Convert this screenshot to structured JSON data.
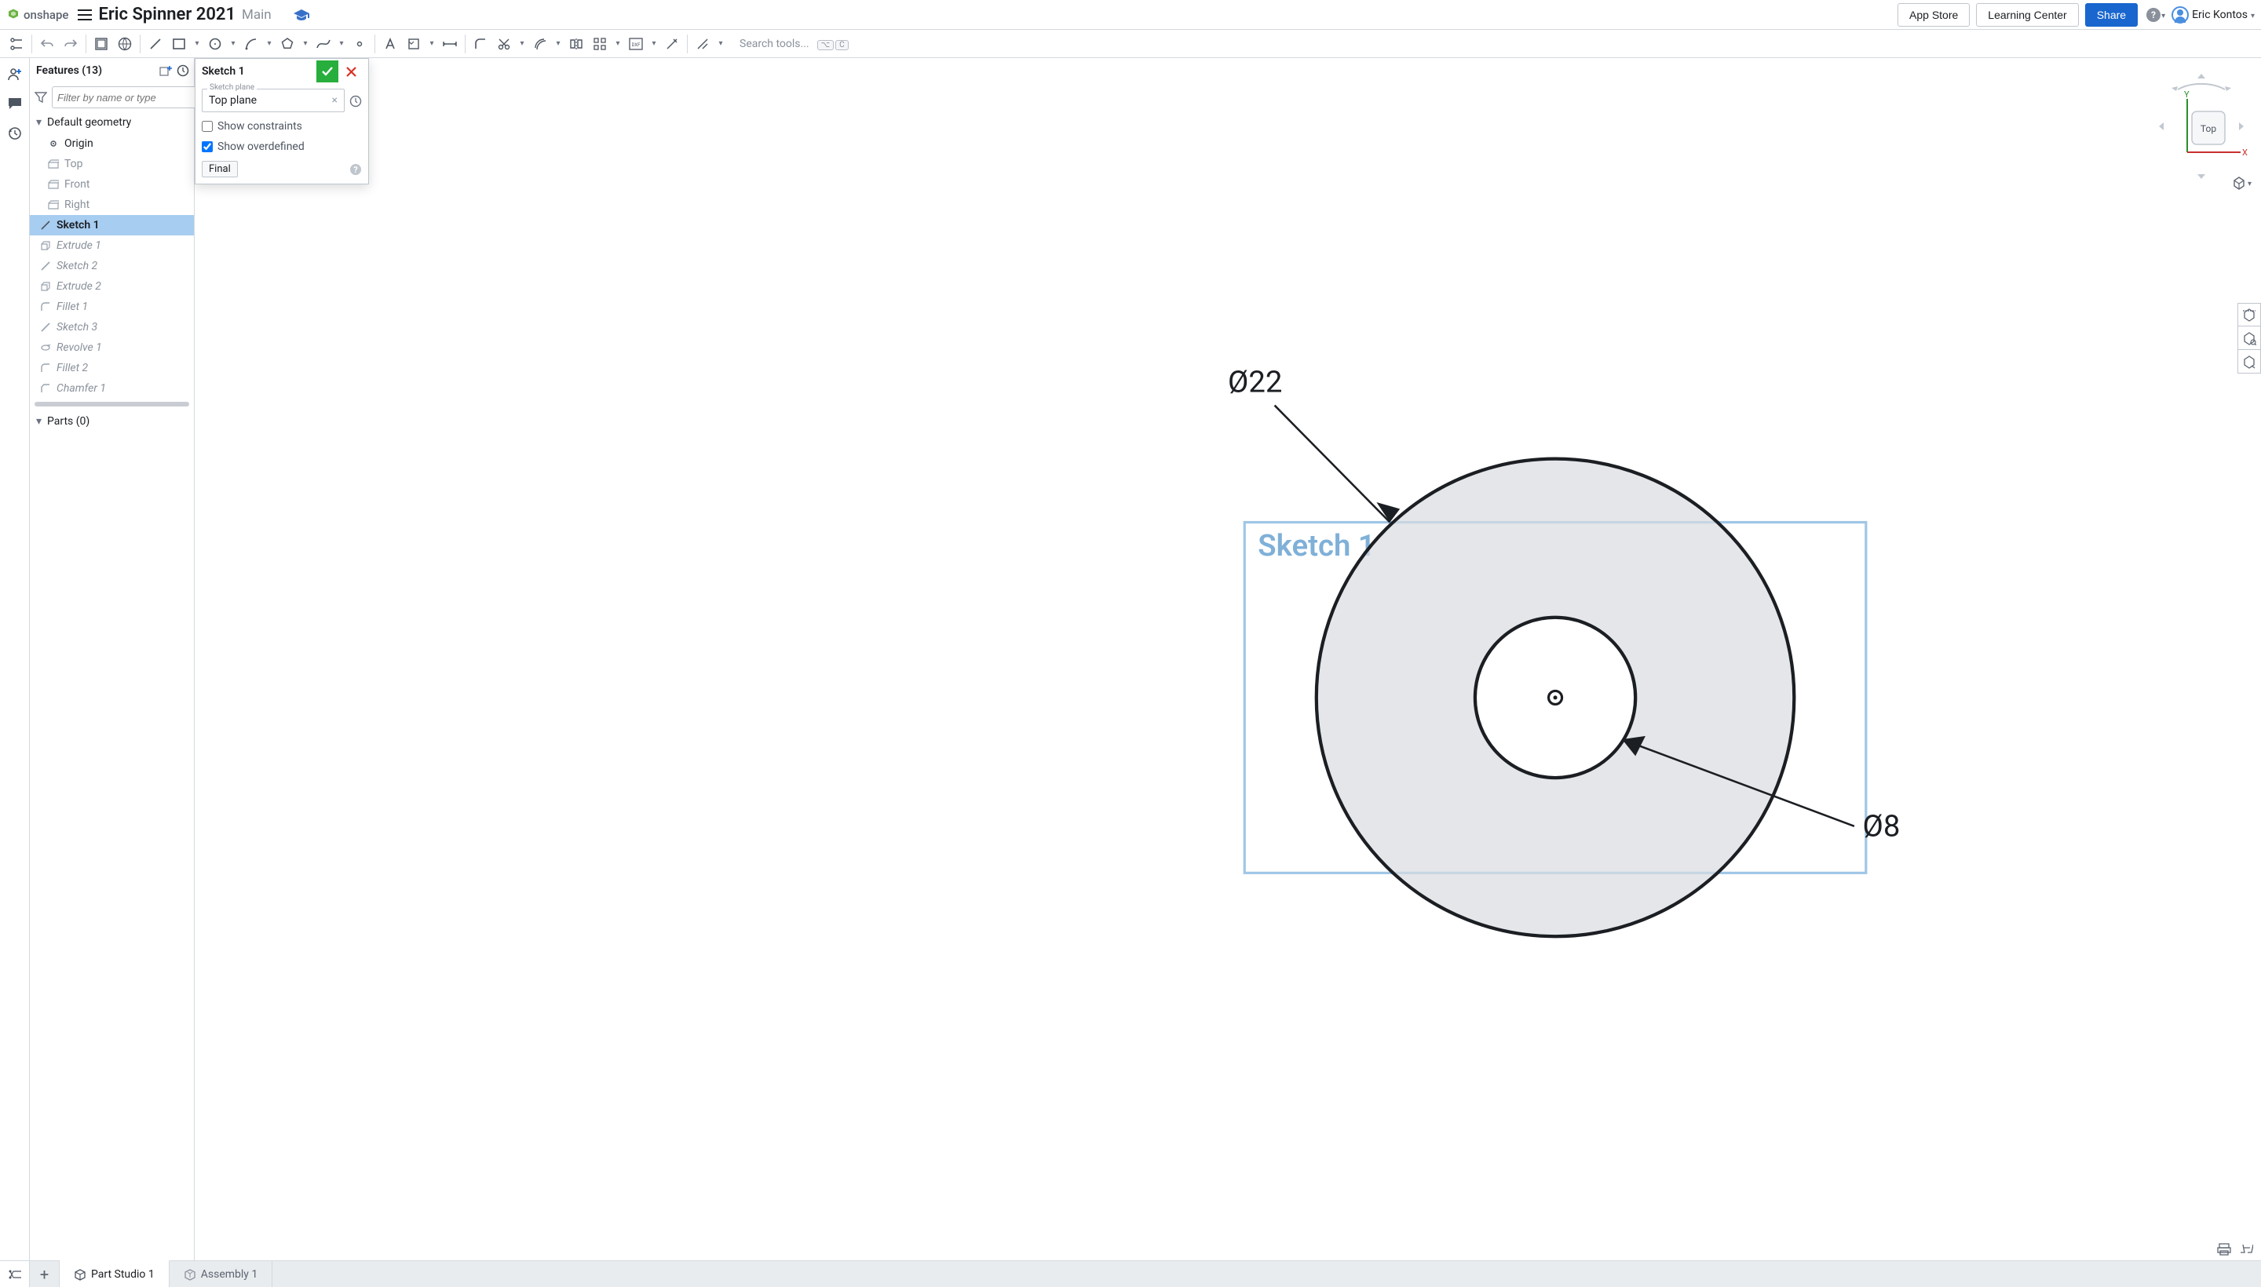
{
  "header": {
    "brand": "onshape",
    "doc_title": "Eric Spinner 2021",
    "doc_sub": "Main",
    "app_store": "App Store",
    "learning_center": "Learning Center",
    "share": "Share",
    "user_name": "Eric Kontos"
  },
  "toolbar": {
    "search_placeholder": "Search tools...",
    "key1": "⌥",
    "key2": "C"
  },
  "features": {
    "title": "Features (13)",
    "filter_placeholder": "Filter by name or type",
    "default_geom": "Default geometry",
    "origin": "Origin",
    "top": "Top",
    "front": "Front",
    "right": "Right",
    "items": [
      {
        "label": "Sketch 1",
        "kind": "sketch",
        "italic": false
      },
      {
        "label": "Extrude 1",
        "kind": "extrude",
        "italic": true
      },
      {
        "label": "Sketch 2",
        "kind": "sketch",
        "italic": true
      },
      {
        "label": "Extrude 2",
        "kind": "extrude",
        "italic": true
      },
      {
        "label": "Fillet 1",
        "kind": "fillet",
        "italic": true
      },
      {
        "label": "Sketch 3",
        "kind": "sketch",
        "italic": true
      },
      {
        "label": "Revolve 1",
        "kind": "revolve",
        "italic": true
      },
      {
        "label": "Fillet 2",
        "kind": "fillet",
        "italic": true
      },
      {
        "label": "Chamfer 1",
        "kind": "chamfer",
        "italic": true
      }
    ],
    "parts": "Parts (0)"
  },
  "dialog": {
    "title": "Sketch 1",
    "plane_label": "Sketch plane",
    "plane_value": "Top plane",
    "show_constraints": "Show constraints",
    "show_overdefined": "Show overdefined",
    "final": "Final"
  },
  "canvas": {
    "dim1": "Ø22",
    "dim2": "Ø8",
    "sketch_label": "Sketch 1",
    "view_label": "Top",
    "axis_y": "Y",
    "axis_x": "X"
  },
  "tabs": {
    "part_studio": "Part Studio 1",
    "assembly": "Assembly 1"
  }
}
